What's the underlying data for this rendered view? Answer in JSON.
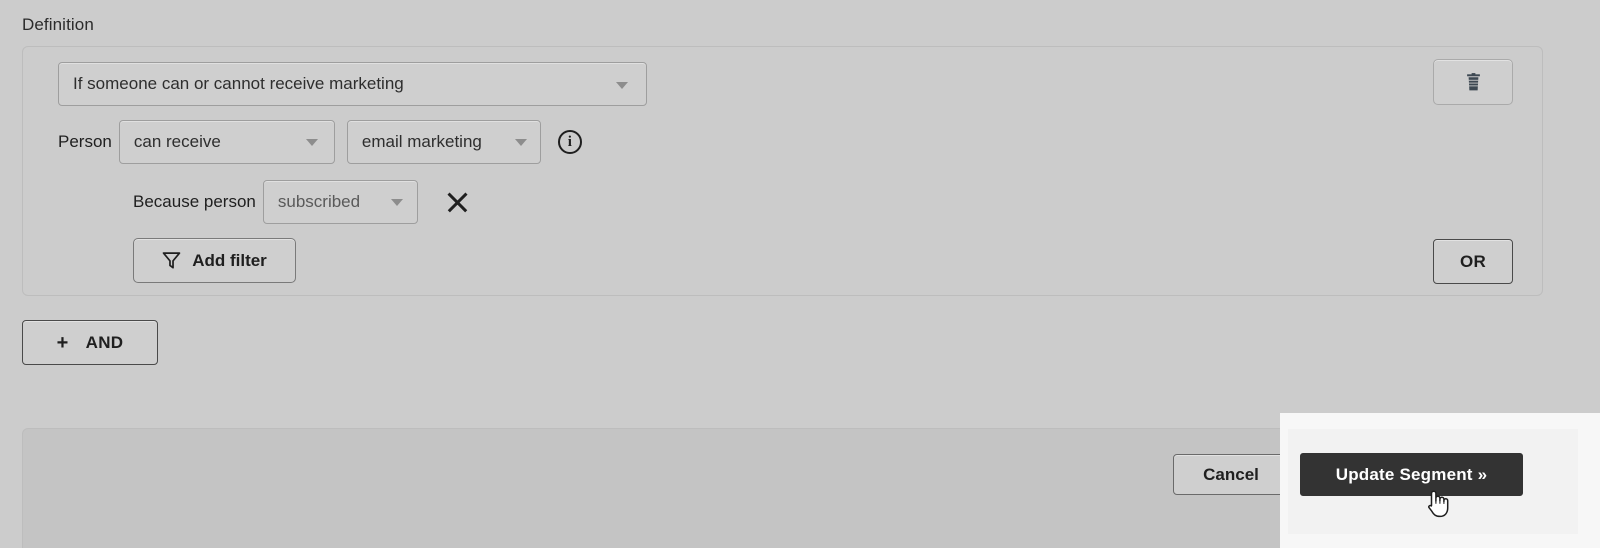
{
  "section": {
    "label": "Definition"
  },
  "definition": {
    "main_condition": {
      "value": "If someone can or cannot receive marketing",
      "caret_icon": "chevron-down-icon"
    },
    "person_row": {
      "label": "Person",
      "condition": {
        "value": "can receive",
        "caret_icon": "chevron-down-icon"
      },
      "channel": {
        "value": "email marketing",
        "caret_icon": "chevron-down-icon"
      },
      "info_icon": "info-circle-icon",
      "info_glyph": "i"
    },
    "because_row": {
      "label": "Because person",
      "reason": {
        "value": "subscribed",
        "caret_icon": "chevron-down-icon"
      },
      "remove_icon": "close-x-icon"
    },
    "add_filter": {
      "label": "Add filter",
      "icon": "funnel-filter-icon"
    },
    "delete_group": {
      "icon": "trash-icon",
      "label": ""
    },
    "or_button": {
      "label": "OR"
    }
  },
  "and_button": {
    "plus_glyph": "+",
    "label": "AND",
    "icon": "plus-icon"
  },
  "footer": {
    "cancel_label": "Cancel",
    "submit_label": "Update Segment »"
  },
  "cursor": {
    "icon": "pointing-hand-cursor"
  },
  "colors": {
    "page_background": "#cccccc",
    "card_border": "#bdbdbd",
    "control_background": "#cfcfcf",
    "control_border": "#9e9e9e",
    "text": "#1f1f1f",
    "muted_text": "#5a5a5a",
    "primary_button_background": "#333333",
    "primary_button_text": "#ffffff",
    "footer_background": "#c4c4c4",
    "spotlight_background": "#f7f7f7"
  }
}
